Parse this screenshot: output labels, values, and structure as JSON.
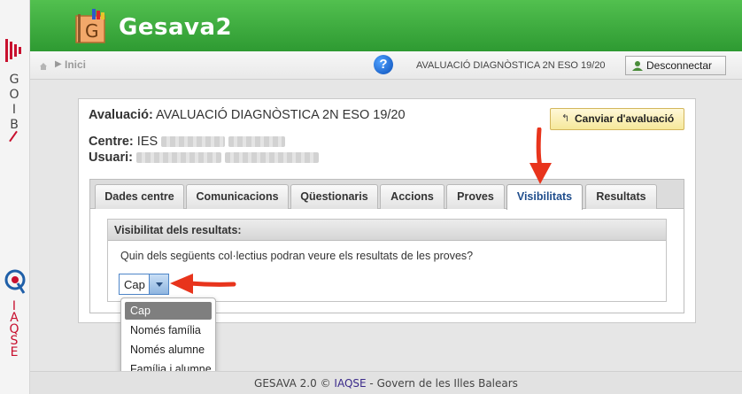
{
  "app": {
    "title": "Gesava2"
  },
  "sidebar": {
    "goib_letters": [
      "G",
      "O",
      "I",
      "B"
    ],
    "iaqse_letters": [
      "I",
      "A",
      "Q",
      "S",
      "E"
    ]
  },
  "breadcrumb": {
    "home": "Inici"
  },
  "topbar": {
    "evaluation_name": "AVALUACIÓ DIAGNÒSTICA 2N ESO 19/20",
    "logout_label": "Desconnectar",
    "help_glyph": "?"
  },
  "panel": {
    "eval_label": "Avaluació:",
    "eval_value": "AVALUACIÓ DIAGNÒSTICA 2N ESO 19/20",
    "change_label": "Canviar d'avaluació",
    "centre_label": "Centre:",
    "centre_value": "IES",
    "usuari_label": "Usuari:"
  },
  "tabs": [
    {
      "label": "Dades centre",
      "active": false
    },
    {
      "label": "Comunicacions",
      "active": false
    },
    {
      "label": "Qüestionaris",
      "active": false
    },
    {
      "label": "Accions",
      "active": false
    },
    {
      "label": "Proves",
      "active": false
    },
    {
      "label": "Visibilitats",
      "active": true
    },
    {
      "label": "Resultats",
      "active": false
    }
  ],
  "visibility": {
    "section_title": "Visibilitat dels resultats:",
    "question": "Quin dels següents col·lectius podran veure els resultats de les proves?",
    "select_value": "Cap",
    "options": [
      "Cap",
      "Només família",
      "Només alumne",
      "Família i alumne"
    ],
    "selected_option": "Cap"
  },
  "footer": {
    "prefix": "GESAVA 2.0 ©",
    "link": "IAQSE",
    "suffix": "- Govern de les Illes Balears"
  },
  "colors": {
    "header_green": "#3aa83b",
    "active_tab_text": "#1f4d8c",
    "annotation_red": "#e8341c",
    "change_button_bg": "#f6e89a"
  }
}
